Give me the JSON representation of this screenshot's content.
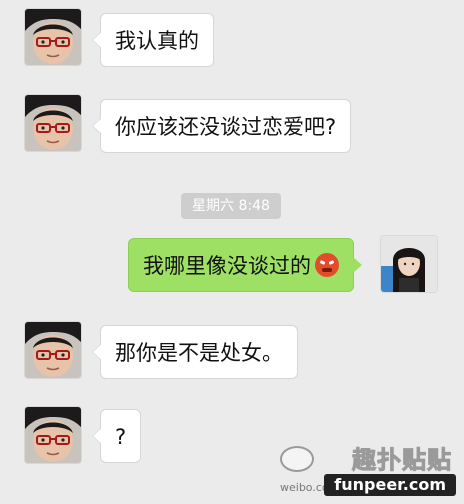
{
  "messages": [
    {
      "sender": "friend",
      "text": "我认真的"
    },
    {
      "sender": "friend",
      "text": "你应该还没谈过恋爱吧?"
    },
    {
      "sender": "me",
      "text": "我哪里像没谈过的",
      "emoji": "angry-face-icon"
    },
    {
      "sender": "friend",
      "text": "那你是不是处女。"
    },
    {
      "sender": "friend",
      "text": "?"
    }
  ],
  "timestamp": "星期六 8:48",
  "watermark": {
    "cn": "趣扑贴贴",
    "url": "funpeer.com",
    "weibo": "weibo.com/"
  },
  "colors": {
    "background": "#ebebeb",
    "incoming_bubble": "#ffffff",
    "outgoing_bubble": "#9ee064",
    "timestamp_bg": "#cecece"
  }
}
